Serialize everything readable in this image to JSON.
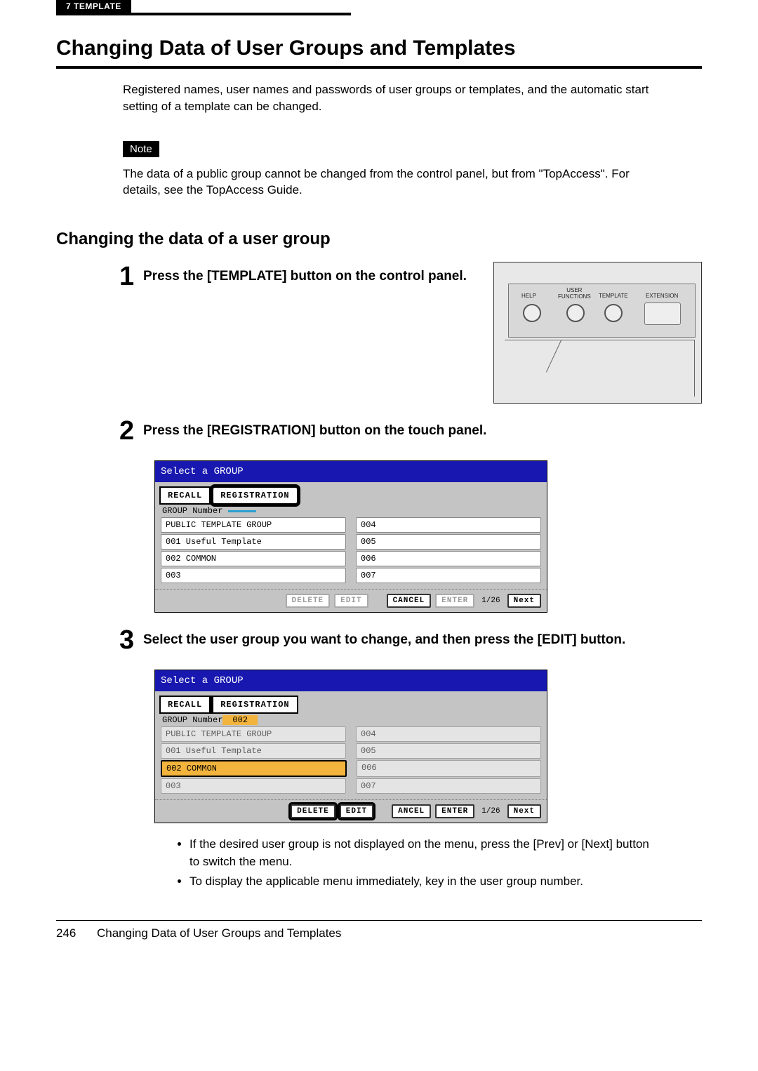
{
  "header": {
    "chapter_tab": "7   TEMPLATE"
  },
  "title": "Changing Data of User Groups and Templates",
  "intro": "Registered names, user names and passwords of user groups or templates, and the automatic start setting of a template can be changed.",
  "note": {
    "badge": "Note",
    "text": "The data of a public group cannot be changed from the control panel, but from \"TopAccess\". For details, see the TopAccess Guide."
  },
  "section_title": "Changing the data of a user group",
  "steps": {
    "1": {
      "num": "1",
      "text": "Press the [TEMPLATE] button on the control panel."
    },
    "2": {
      "num": "2",
      "text": "Press the [REGISTRATION] button on the touch panel."
    },
    "3": {
      "num": "3",
      "text": "Select the user group you want to change, and then press the [EDIT] button."
    }
  },
  "panel": {
    "help": "HELP",
    "user_functions": "USER\nFUNCTIONS",
    "template": "TEMPLATE",
    "extension": "EXTENSION"
  },
  "screen1": {
    "title": "Select a GROUP",
    "tab_recall": "RECALL",
    "tab_registration": "REGISTRATION",
    "group_number_label": "GROUP Number",
    "rows_left": [
      "PUBLIC TEMPLATE GROUP",
      "001 Useful Template",
      "002 COMMON",
      "003"
    ],
    "rows_right": [
      "004",
      "005",
      "006",
      "007"
    ],
    "buttons": {
      "delete": "DELETE",
      "edit": "EDIT",
      "cancel": "CANCEL",
      "enter": "ENTER",
      "next": "Next",
      "page": "1/26"
    }
  },
  "screen2": {
    "title": "Select a GROUP",
    "tab_recall": "RECALL",
    "tab_registration": "REGISTRATION",
    "group_number_label": "GROUP Number",
    "group_number_value": "002",
    "rows_left": [
      "PUBLIC TEMPLATE GROUP",
      "001 Useful Template",
      "002 COMMON",
      "003"
    ],
    "rows_right": [
      "004",
      "005",
      "006",
      "007"
    ],
    "buttons": {
      "delete": "DELETE",
      "edit": "EDIT",
      "cancel": "ANCEL",
      "enter": "ENTER",
      "next": "Next",
      "page": "1/26"
    }
  },
  "bullets": {
    "0": "If the desired user group is not displayed on the menu, press the [Prev] or [Next] button to switch the menu.",
    "1": "To display the applicable menu immediately, key in the user group number."
  },
  "footer": {
    "page_number": "246",
    "footer_title": "Changing Data of User Groups and Templates"
  }
}
